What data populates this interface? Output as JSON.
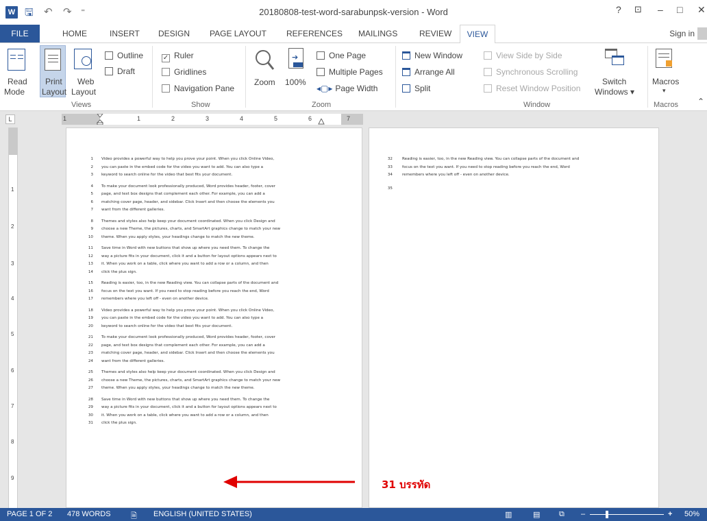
{
  "window": {
    "title": "20180808-test-word-sarabunpsk-version - Word",
    "help": "?",
    "ribbon_display": "⊡",
    "minimize": "–",
    "maximize": "□",
    "close": "✕",
    "app_icon": "W",
    "qa_save": "🖫",
    "qa_undo": "↶",
    "qa_redo": "↷",
    "qa_customize": "⁼"
  },
  "tabs": {
    "file": "FILE",
    "home": "HOME",
    "insert": "INSERT",
    "design": "DESIGN",
    "page_layout": "PAGE LAYOUT",
    "references": "REFERENCES",
    "mailings": "MAILINGS",
    "review": "REVIEW",
    "view": "VIEW",
    "sign_in": "Sign in"
  },
  "ribbon": {
    "views": {
      "label": "Views",
      "read_mode_1": "Read",
      "read_mode_2": "Mode",
      "print_layout_1": "Print",
      "print_layout_2": "Layout",
      "web_layout_1": "Web",
      "web_layout_2": "Layout",
      "outline": "Outline",
      "draft": "Draft"
    },
    "show": {
      "label": "Show",
      "ruler": "Ruler",
      "ruler_checked": true,
      "gridlines": "Gridlines",
      "navigation_pane": "Navigation Pane"
    },
    "zoom": {
      "label": "Zoom",
      "zoom": "Zoom",
      "hundred": "100%",
      "one_page": "One Page",
      "multiple_pages": "Multiple Pages",
      "page_width": "Page Width"
    },
    "window": {
      "label": "Window",
      "new_window": "New Window",
      "arrange_all": "Arrange All",
      "split": "Split",
      "view_side_by_side": "View Side by Side",
      "synchronous_scrolling": "Synchronous Scrolling",
      "reset_window_position": "Reset Window Position",
      "switch_windows_1": "Switch",
      "switch_windows_2": "Windows ▾"
    },
    "macros": {
      "label": "Macros",
      "macros": "Macros",
      "dropdown": "▾"
    },
    "collapse": "⌃"
  },
  "ruler": {
    "corner": "L",
    "numbers": [
      "1",
      "1",
      "2",
      "3",
      "4",
      "5",
      "6",
      "7"
    ]
  },
  "vruler": {
    "numbers": [
      "1",
      "2",
      "3",
      "4",
      "5",
      "6",
      "7",
      "8",
      "9"
    ]
  },
  "document": {
    "page1_lines": [
      {
        "n": "1",
        "t": "Video provides a powerful way to help you prove your point. When you click Online Video,"
      },
      {
        "n": "2",
        "t": "you can paste in the embed code for the video you want to add. You can also type a"
      },
      {
        "n": "3",
        "t": "keyword to search online for the video that best fits your document."
      },
      {
        "n": "4",
        "t": "To make your document look professionally produced, Word provides header, footer, cover"
      },
      {
        "n": "5",
        "t": "page, and text box designs that complement each other. For example, you can add a"
      },
      {
        "n": "6",
        "t": "matching cover page, header, and sidebar. Click Insert and then choose the elements you"
      },
      {
        "n": "7",
        "t": "want from the different galleries."
      },
      {
        "n": "8",
        "t": "Themes and styles also help keep your document coordinated. When you click Design and"
      },
      {
        "n": "9",
        "t": "choose a new Theme, the pictures, charts, and SmartArt graphics change to match your new"
      },
      {
        "n": "10",
        "t": "theme. When you apply styles, your headings change to match the new theme."
      },
      {
        "n": "11",
        "t": "Save time in Word with new buttons that show up where you need them. To change the"
      },
      {
        "n": "12",
        "t": "way a picture fits in your document, click it and a button for layout options appears next to"
      },
      {
        "n": "13",
        "t": "it. When you work on a table, click where you want to add a row or a column, and then"
      },
      {
        "n": "14",
        "t": "click the plus sign."
      },
      {
        "n": "15",
        "t": "Reading is easier, too, in the new Reading view. You can collapse parts of the document and"
      },
      {
        "n": "16",
        "t": "focus on the text you want. If you need to stop reading before you reach the end, Word"
      },
      {
        "n": "17",
        "t": "remembers where you left off - even on another device."
      },
      {
        "n": "18",
        "t": "Video provides a powerful way to help you prove your point. When you click Online Video,"
      },
      {
        "n": "19",
        "t": "you can paste in the embed code for the video you want to add. You can also type a"
      },
      {
        "n": "20",
        "t": "keyword to search online for the video that best fits your document."
      },
      {
        "n": "21",
        "t": "To make your document look professionally produced, Word provides header, footer, cover"
      },
      {
        "n": "22",
        "t": "page, and text box designs that complement each other. For example, you can add a"
      },
      {
        "n": "23",
        "t": "matching cover page, header, and sidebar. Click Insert and then choose the elements you"
      },
      {
        "n": "24",
        "t": "want from the different galleries."
      },
      {
        "n": "25",
        "t": "Themes and styles also help keep your document coordinated. When you click Design and"
      },
      {
        "n": "26",
        "t": "choose a new Theme, the pictures, charts, and SmartArt graphics change to match your new"
      },
      {
        "n": "27",
        "t": "theme. When you apply styles, your headings change to match the new theme."
      },
      {
        "n": "28",
        "t": "Save time in Word with new buttons that show up where you need them. To change the"
      },
      {
        "n": "29",
        "t": "way a picture fits in your document, click it and a button for layout options appears next to"
      },
      {
        "n": "30",
        "t": "it. When you work on a table, click where you want to add a row or a column, and then"
      },
      {
        "n": "31",
        "t": "click the plus sign."
      }
    ],
    "page2_lines": [
      {
        "n": "32",
        "t": "Reading is easier, too, in the new Reading view. You can collapse parts of the document and"
      },
      {
        "n": "33",
        "t": "focus on the text you want. If you need to stop reading before you reach the end, Word"
      },
      {
        "n": "34",
        "t": "remembers where you left off - even on another device."
      },
      {
        "n": "35",
        "t": ""
      }
    ]
  },
  "annotation": {
    "text": "31 บรรทัด",
    "color": "#e00000"
  },
  "status": {
    "page": "PAGE 1 OF 2",
    "words": "478 WORDS",
    "proofing_icon": "🗎",
    "language": "ENGLISH (UNITED STATES)",
    "zoom": "50%",
    "zoom_minus": "–",
    "zoom_plus": "+"
  },
  "colors": {
    "accent": "#2b579a",
    "status_bar": "#2b579a",
    "workspace": "#e6e6e6"
  }
}
